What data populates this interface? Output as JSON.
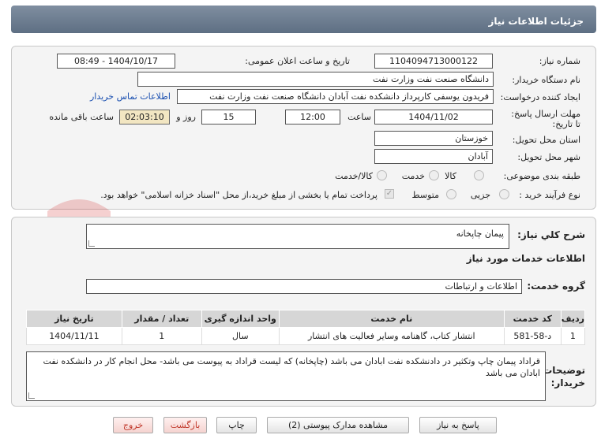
{
  "header": {
    "title": "جزئیات اطلاعات نیاز"
  },
  "form": {
    "need_number_label": "شماره نیاز:",
    "need_number": "1104094713000122",
    "announce_label": "تاریخ و ساعت اعلان عمومی:",
    "announce_value": "1404/10/17 - 08:49",
    "buyer_org_label": "نام دستگاه خریدار:",
    "buyer_org": "دانشگاه صنعت نفت وزارت نفت",
    "creator_label": "ایجاد کننده درخواست:",
    "creator": "فریدون یوسفی کارپرداز دانشکده نفت آبادان دانشگاه صنعت نفت وزارت نفت",
    "contact_link": "اطلاعات تماس خریدار",
    "deadline_label": "مهلت ارسال پاسخ: تا تاریخ:",
    "deadline_date": "1404/11/02",
    "time_label": "ساعت",
    "deadline_time": "12:00",
    "days_value": "15",
    "days_label": "روز و",
    "remaining_time": "02:03:10",
    "remaining_label": "ساعت باقی مانده",
    "province_label": "استان محل تحویل:",
    "province": "خوزستان",
    "city_label": "شهر محل تحویل:",
    "city": "آبادان",
    "category_label": "طبقه بندی موضوعی:",
    "category_options": [
      "کالا",
      "خدمت",
      "کالا/خدمت"
    ],
    "process_label": "نوع فرآیند خرید :",
    "process_options": [
      "جزیی",
      "متوسط"
    ],
    "payment_note": "پرداخت تمام یا بخشی از مبلغ خرید،از محل \"اسناد خزانه اسلامی\" خواهد بود."
  },
  "details": {
    "summary_label": "شرح کلي نياز:",
    "summary": "پیمان چاپخانه",
    "services_heading": "اطلاعات خدمات مورد نیاز",
    "service_group_label": "گروه خدمت:",
    "service_group": "اطلاعات و ارتباطات",
    "table": {
      "headers": [
        "ردیف",
        "کد خدمت",
        "نام خدمت",
        "واحد اندازه گیری",
        "تعداد / مقدار",
        "تاریخ نیاز"
      ],
      "rows": [
        [
          "1",
          "د-58-581",
          "انتشار کتاب، گاهنامه وسایر فعالیت های انتشار",
          "سال",
          "1",
          "1404/11/11"
        ]
      ]
    },
    "buyer_notes_label": "توضیحات خریدار:",
    "buyer_notes": "قراداد پیمان چاپ وتکثیر در دادنشکده نفت ابادان می باشد (چاپخانه) که لیست قراداد به پیوست می باشد- محل انجام کار در دانشکده نفت ابادان می باشد"
  },
  "buttons": {
    "reply": "پاسخ به نیاز",
    "attachments": "مشاهده مدارک پیوستی (2)",
    "print": "چاپ",
    "back": "بازگشت",
    "exit": "خروج"
  },
  "watermark": "AriaTender.net",
  "colors": {
    "header": "#6b7a8e",
    "time_box": "#f2e6c2",
    "link": "#1a4fb0",
    "exit_text": "#c0392b"
  }
}
